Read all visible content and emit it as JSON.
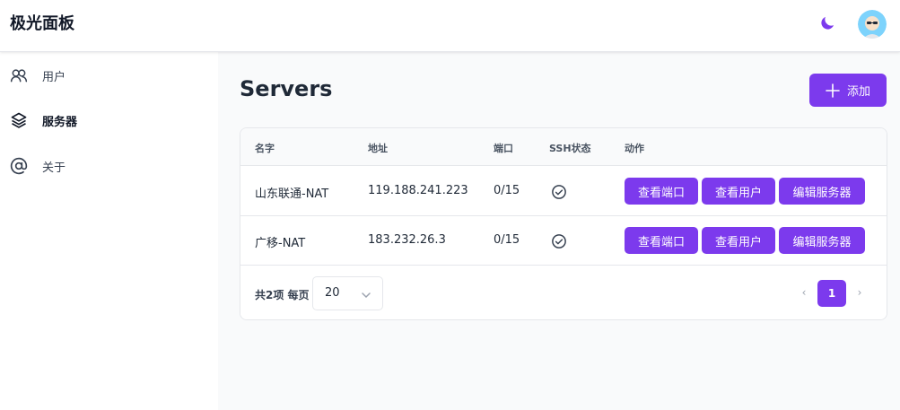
{
  "app": {
    "title": "极光面板"
  },
  "colors": {
    "accent": "#7c3aed",
    "background": "#f9fafb"
  },
  "header": {
    "theme_icon": "moon-icon",
    "avatar_icon": "avatar-icon"
  },
  "sidebar": {
    "items": [
      {
        "label": "用户",
        "icon": "users-icon"
      },
      {
        "label": "服务器",
        "icon": "layers-icon",
        "active": true
      },
      {
        "label": "关于",
        "icon": "at-icon"
      }
    ]
  },
  "main": {
    "title": "Servers",
    "add_label": "添加",
    "table": {
      "columns": [
        "名字",
        "地址",
        "端口",
        "SSH状态",
        "动作"
      ],
      "rows": [
        {
          "name": "山东联通-NAT",
          "address": "119.188.241.223",
          "ports": "0/15",
          "ssh": "ok"
        },
        {
          "name": "广移-NAT",
          "address": "183.232.26.3",
          "ports": "0/15",
          "ssh": "ok"
        }
      ],
      "actions": [
        "查看端口",
        "查看用户",
        "编辑服务器"
      ]
    },
    "footer": {
      "total": "共2项 每页",
      "page_size": "20",
      "current_page": "1"
    }
  }
}
